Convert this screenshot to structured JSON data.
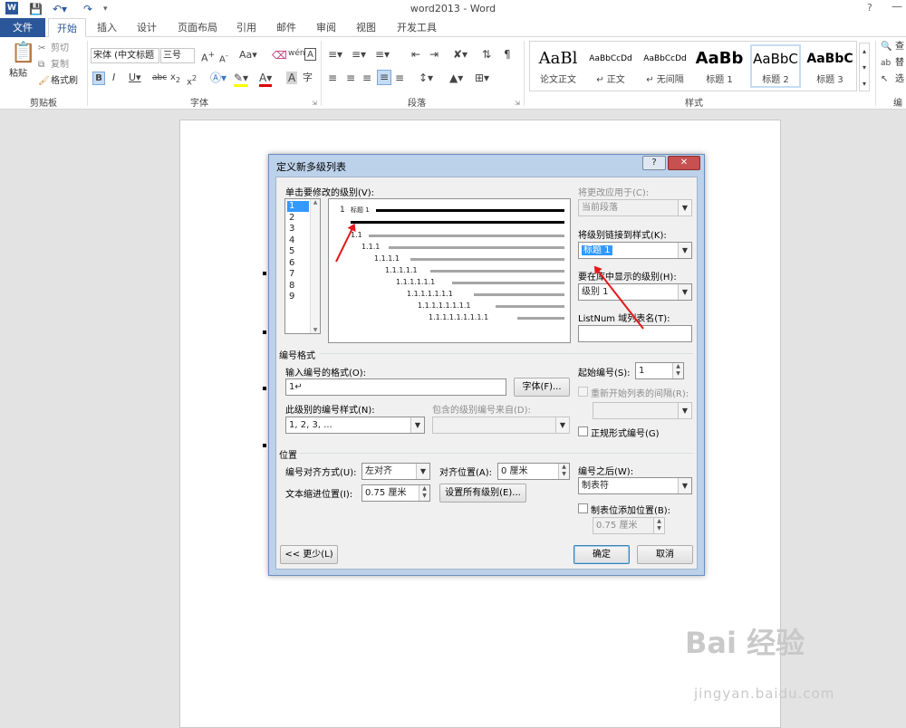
{
  "window": {
    "title": "word2013 - Word",
    "help": "?",
    "minimize": "—"
  },
  "tabs": [
    "文件",
    "开始",
    "插入",
    "设计",
    "页面布局",
    "引用",
    "邮件",
    "审阅",
    "视图",
    "开发工具"
  ],
  "ribbon": {
    "clipboard": {
      "paste": "粘贴",
      "cut": "剪切",
      "copy": "复制",
      "format_painter": "格式刷",
      "label": "剪贴板"
    },
    "font": {
      "name": "宋体 (中文标题",
      "size": "三号",
      "label": "字体"
    },
    "paragraph": {
      "label": "段落"
    },
    "styles": {
      "label": "样式",
      "items": [
        {
          "preview": "AaBl",
          "name": "论文正文"
        },
        {
          "preview": "AaBbCcDd",
          "name": "↵ 正文"
        },
        {
          "preview": "AaBbCcDd",
          "name": "↵ 无间隔"
        },
        {
          "preview": "AaBb",
          "name": "标题 1"
        },
        {
          "preview": "AaBbC",
          "name": "标题 2"
        },
        {
          "preview": "AaBbC",
          "name": "标题 3"
        }
      ]
    },
    "editing": {
      "find": "查",
      "replace": "替",
      "select": "选",
      "label": "编"
    }
  },
  "dialog": {
    "title": "定义新多级列表",
    "help_btn": "?",
    "close_btn": "✕",
    "level_label": "单击要修改的级别(V):",
    "levels": [
      "1",
      "2",
      "3",
      "4",
      "5",
      "6",
      "7",
      "8",
      "9"
    ],
    "preview_lines": [
      "1",
      "标题 1",
      "1.1",
      "1.1.1",
      "1.1.1.1",
      "1.1.1.1.1",
      "1.1.1.1.1.1",
      "1.1.1.1.1.1.1",
      "1.1.1.1.1.1.1.1",
      "1.1.1.1.1.1.1.1.1"
    ],
    "apply_to_label": "将更改应用于(C):",
    "apply_to_value": "当前段落",
    "link_style_label": "将级别链接到样式(K):",
    "link_style_value": "标题 1",
    "gallery_level_label": "要在库中显示的级别(H):",
    "gallery_level_value": "级别 1",
    "listnum_label": "ListNum 域列表名(T):",
    "listnum_value": "",
    "number_format_section": "编号格式",
    "enter_format_label": "输入编号的格式(O):",
    "enter_format_value": "1↵",
    "font_btn": "字体(F)...",
    "start_at_label": "起始编号(S):",
    "start_at_value": "1",
    "restart_label": "重新开始列表的间隔(R):",
    "number_style_label": "此级别的编号样式(N):",
    "number_style_value": "1, 2, 3, ...",
    "include_from_label": "包含的级别编号来自(D):",
    "legal_label": "正规形式编号(G)",
    "position_section": "位置",
    "alignment_label": "编号对齐方式(U):",
    "alignment_value": "左对齐",
    "aligned_at_label": "对齐位置(A):",
    "aligned_at_value": "0 厘米",
    "follow_label": "编号之后(W):",
    "follow_value": "制表符",
    "indent_label": "文本缩进位置(I):",
    "indent_value": "0.75 厘米",
    "set_all_btn": "设置所有级别(E)...",
    "tab_stop_label": "制表位添加位置(B):",
    "tab_stop_value": "0.75 厘米",
    "less_btn": "<< 更少(L)",
    "ok_btn": "确定",
    "cancel_btn": "取消"
  },
  "watermark": {
    "brand": "Bai 经验",
    "url": "jingyan.baidu.com"
  },
  "colors": {
    "accent": "#2b579a",
    "arrow": "#e5191b",
    "selection": "#3399ff"
  }
}
